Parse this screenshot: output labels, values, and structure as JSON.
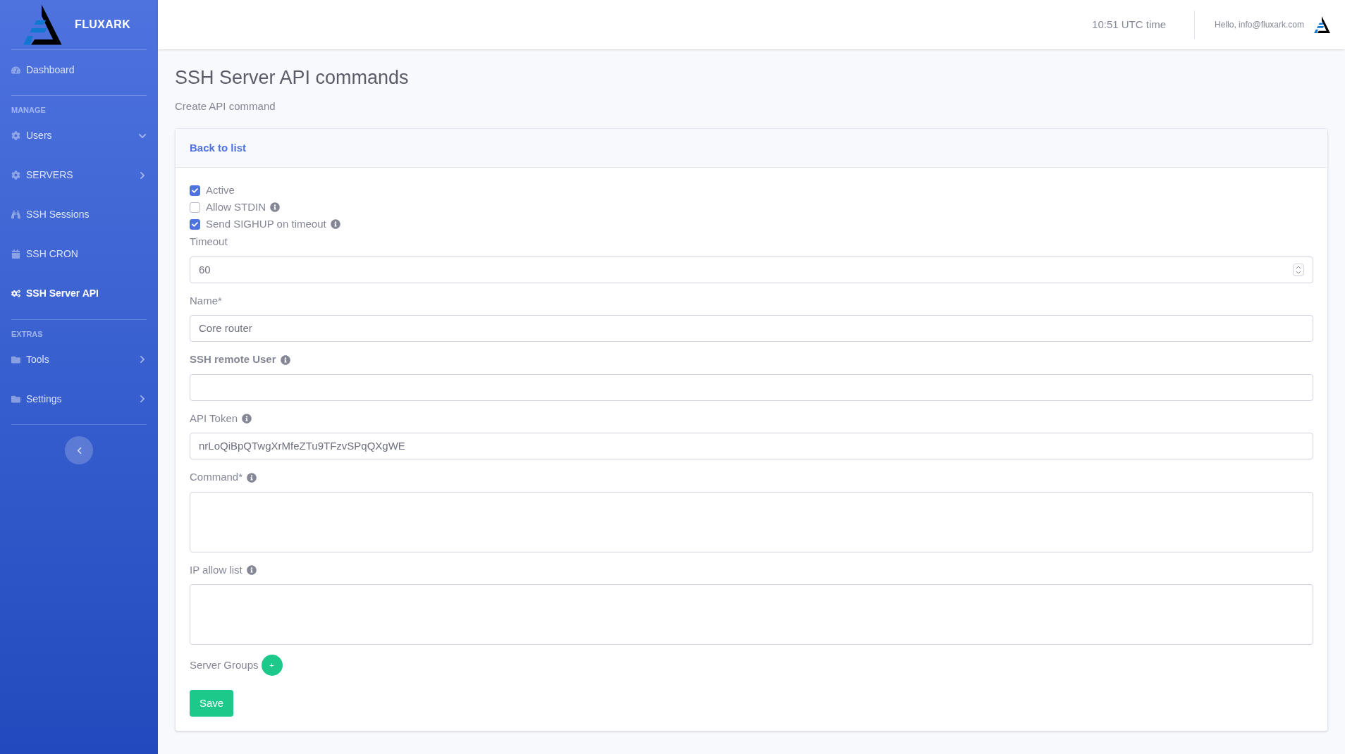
{
  "brand": {
    "name": "FLUXARK"
  },
  "sidebar": {
    "sections": [
      {
        "items": [
          {
            "label": "Dashboard",
            "selected": false
          }
        ]
      },
      {
        "heading": "MANAGE",
        "items": [
          {
            "label": "Users",
            "selected": false,
            "expanded": true
          },
          {
            "label": "SERVERS",
            "selected": false,
            "expanded": false
          },
          {
            "label": "SSH Sessions",
            "selected": false
          },
          {
            "label": "SSH CRON",
            "selected": false
          },
          {
            "label": "SSH Server API",
            "selected": true
          }
        ]
      },
      {
        "heading": "EXTRAS",
        "items": [
          {
            "label": "Tools",
            "selected": false,
            "expanded": false
          },
          {
            "label": "Settings",
            "selected": false,
            "expanded": false
          }
        ]
      }
    ]
  },
  "header": {
    "time": "10:51 UTC time",
    "greeting": "Hello, info@fluxark.com"
  },
  "page": {
    "title": "SSH Server API commands",
    "subtitle": "Create API command"
  },
  "card": {
    "back_link": "Back to list",
    "checkboxes": [
      {
        "label": "Active",
        "checked": true,
        "info": false
      },
      {
        "label": "Allow STDIN",
        "checked": false,
        "info": true
      },
      {
        "label": "Send SIGHUP on timeout",
        "checked": true,
        "info": true
      }
    ],
    "fields": [
      {
        "kind": "number",
        "label": "Timeout",
        "value": "60",
        "info": false,
        "bold": false
      },
      {
        "kind": "text",
        "label": "Name*",
        "value": "Core router",
        "info": false,
        "bold": false
      },
      {
        "kind": "text",
        "label": "SSH remote User",
        "info": true,
        "bold": true
      },
      {
        "kind": "text",
        "label": "API Token",
        "value": "nrLoQiBpQTwgXrMfeZTu9TFzvSPqQXgWE",
        "info": true,
        "bold": false
      },
      {
        "kind": "textarea",
        "label": "Command*",
        "info": true,
        "bold": false
      },
      {
        "kind": "textarea",
        "label": "IP allow list",
        "info": true,
        "bold": false
      },
      {
        "kind": "groups",
        "label": "Server Groups",
        "button": "+",
        "info": false,
        "bold": false
      }
    ],
    "save": "Save"
  }
}
